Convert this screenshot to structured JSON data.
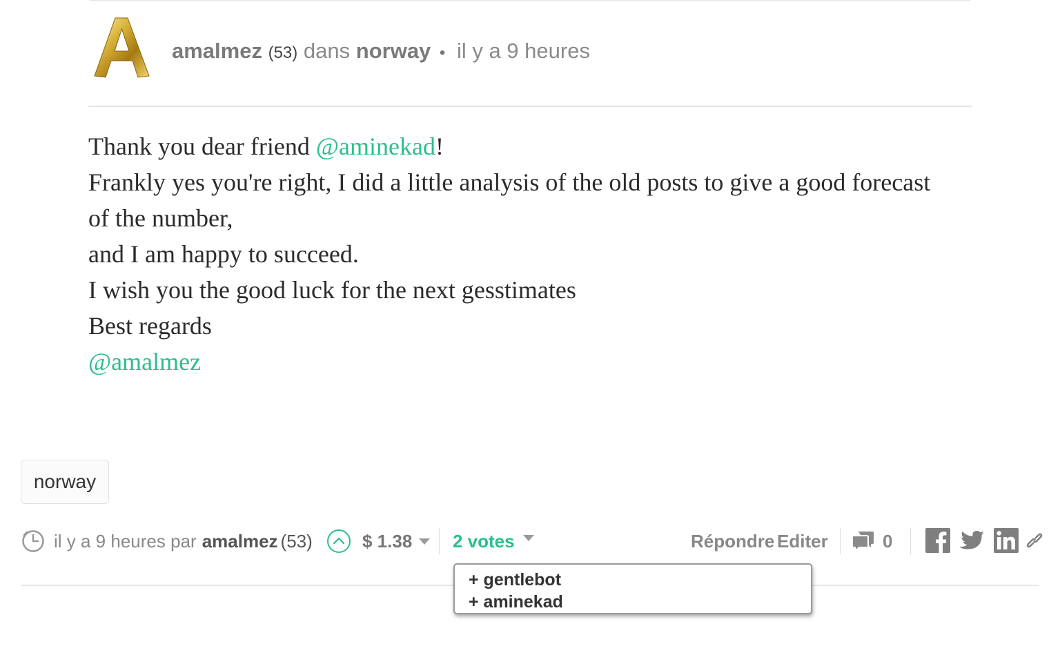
{
  "post": {
    "author": "amalmez",
    "author_rep": "(53)",
    "in_label": "dans",
    "community": "norway",
    "bullet": "•",
    "age": "il y a 9 heures",
    "avatar_icon": "gold-letter-a-avatar",
    "body": {
      "line1_prefix": "Thank you dear friend ",
      "line1_mention": "@aminekad",
      "line1_suffix": "!",
      "line2": "Frankly yes you're right, I did a little analysis of the old posts to give a good forecast of the number,",
      "line3": "and I am happy to succeed.",
      "line4": "I wish you the good luck for the next gesstimates",
      "line5": "Best regards",
      "signature_mention": "@amalmez"
    },
    "tag": "norway"
  },
  "footer": {
    "clock_icon": "clock-icon",
    "age": "il y a 9 heures",
    "by_label": "par",
    "author": "amalmez",
    "author_rep": "(53)",
    "upvote_icon": "upvote-chevron-icon",
    "payout": "$ 1.38",
    "votes_label": "2 votes",
    "reply_label": "Répondre",
    "edit_label": "Editer",
    "comments_icon": "comments-icon",
    "comments_count": "0",
    "share_icons": [
      "facebook-icon",
      "twitter-icon",
      "linkedin-icon",
      "link-icon"
    ]
  },
  "voters_dropdown": {
    "items": [
      "+ gentlebot",
      "+ aminekad"
    ]
  },
  "colors": {
    "accent": "#2bbf8a",
    "muted_text": "#888888",
    "body_text": "#2b2b2b",
    "divider": "#e4e4e4"
  }
}
